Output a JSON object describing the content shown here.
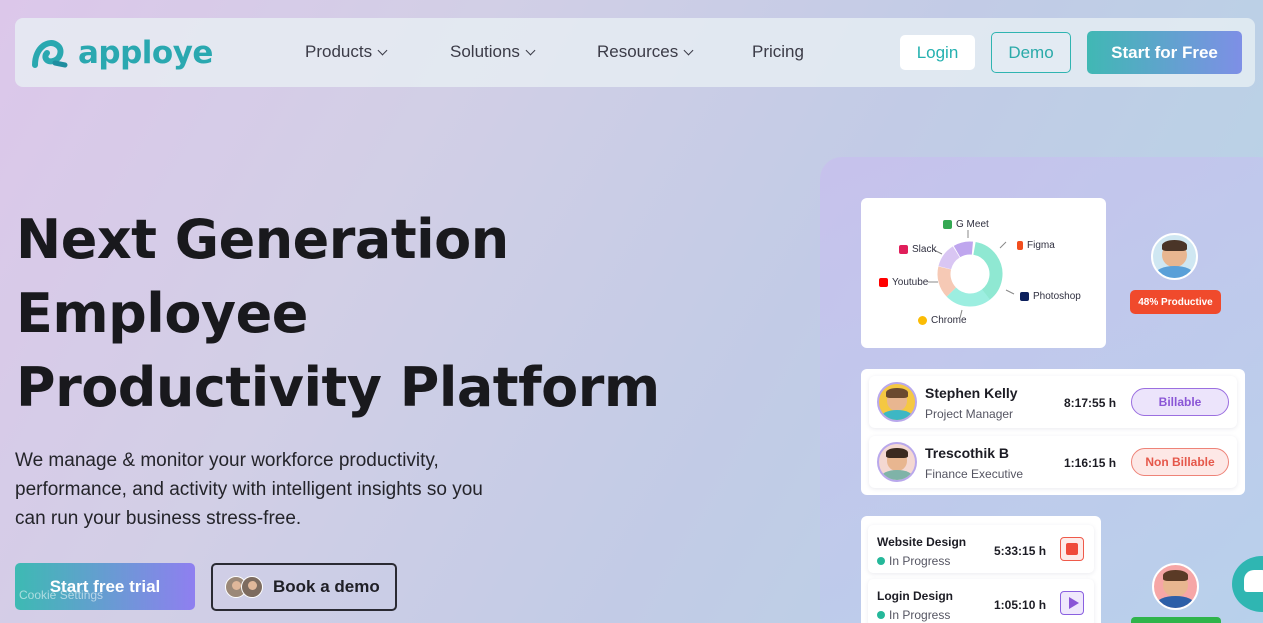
{
  "brand": {
    "name": "apploye"
  },
  "nav": {
    "items": [
      {
        "label": "Products"
      },
      {
        "label": "Solutions"
      },
      {
        "label": "Resources"
      },
      {
        "label": "Pricing"
      }
    ],
    "login": "Login",
    "demo": "Demo",
    "start": "Start for Free"
  },
  "hero": {
    "title_lines": [
      "Next Generation",
      "Employee",
      "Productivity Platform"
    ],
    "subtitle_lines": [
      "We manage & monitor your workforce productivity,",
      "performance, and activity with intelligent insights so you",
      "can run your business stress-free."
    ],
    "cta_trial": "Start free trial",
    "cta_book": "Book a demo",
    "cookie": "Cookie Settings"
  },
  "illustration": {
    "apps": [
      "G Meet",
      "Figma",
      "Slack",
      "Youtube",
      "Photoshop",
      "Chrome"
    ],
    "productive_badge": "48% Productive",
    "employees": [
      {
        "name": "Stephen Kelly",
        "role": "Project Manager",
        "time": "8:17:55 h",
        "tag": "Billable"
      },
      {
        "name": "Trescothik B",
        "role": "Finance Executive",
        "time": "1:16:15 h",
        "tag": "Non Billable"
      }
    ],
    "tasks": [
      {
        "name": "Website Design",
        "status": "In Progress",
        "time": "5:33:15 h"
      },
      {
        "name": "Login Design",
        "status": "In Progress",
        "time": "1:05:10 h"
      }
    ]
  },
  "colors": {
    "brand_teal": "#2aa8b0",
    "accent_purple": "#8a56d6",
    "badge_red": "#f04a2c"
  }
}
